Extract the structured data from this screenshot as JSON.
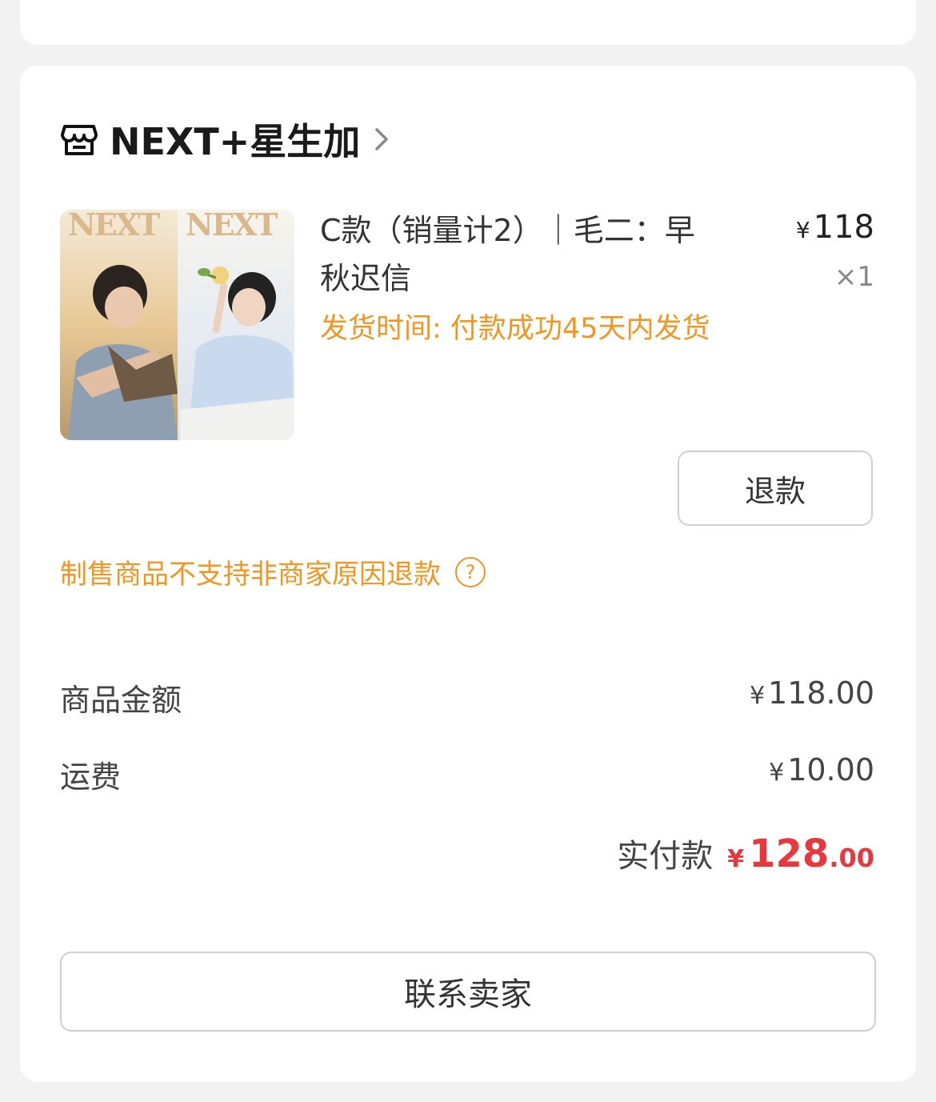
{
  "shop": {
    "name": "NEXT+星生加",
    "icon": "store-icon",
    "chevron": "chevron-right-icon"
  },
  "product": {
    "title": "C款（销量计2）｜毛二：早秋迟信",
    "shipping_note": "发货时间: 付款成功45天内发货",
    "price_symbol": "¥",
    "price": "118",
    "quantity": "×1",
    "thumb_text_left": "NEXT",
    "thumb_text_right": "NEXT",
    "refund_label": "退款"
  },
  "notice": {
    "text": "制售商品不支持非商家原因退款",
    "help_symbol": "?"
  },
  "summary": {
    "goods_label": "商品金额",
    "goods_symbol": "¥",
    "goods_value": "118.00",
    "shipping_label": "运费",
    "shipping_symbol": "¥",
    "shipping_value": "10.00",
    "paid_label": "实付款",
    "paid_symbol": "¥",
    "paid_int": "128",
    "paid_dec": ".00"
  },
  "actions": {
    "contact_label": "联系卖家"
  },
  "colors": {
    "accent_orange": "#f5941e",
    "price_red": "#e8383d"
  }
}
